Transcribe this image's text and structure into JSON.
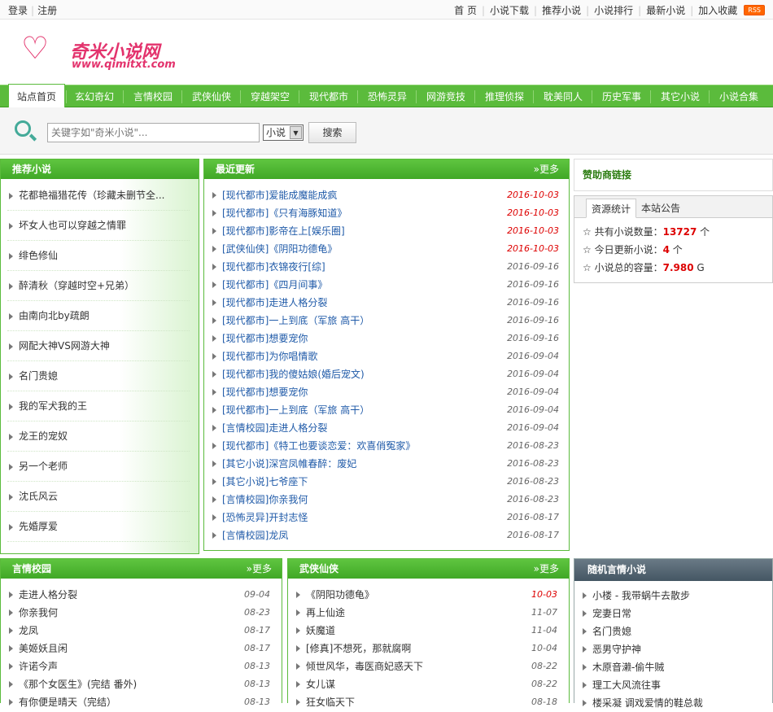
{
  "topbar": {
    "login": "登录",
    "register": "注册",
    "links": [
      "首 页",
      "小说下载",
      "推荐小说",
      "小说排行",
      "最新小说",
      "加入收藏"
    ],
    "rss": "RSS"
  },
  "logo": {
    "title": "奇米小说网",
    "domain": "www.qimitxt.com",
    "heart": "♡"
  },
  "nav": {
    "items": [
      "站点首页",
      "玄幻奇幻",
      "言情校园",
      "武侠仙侠",
      "穿越架空",
      "现代都市",
      "恐怖灵异",
      "网游竞技",
      "推理侦探",
      "耽美同人",
      "历史军事",
      "其它小说",
      "小说合集"
    ]
  },
  "search": {
    "placeholder": "关键字如\"奇米小说\"...",
    "select_value": "小说",
    "button": "搜索"
  },
  "recommend": {
    "title": "推荐小说",
    "items": [
      "花都艳福猎花传（珍藏未删节全...",
      "坏女人也可以穿越之情罪",
      "绯色修仙",
      "醉清秋（穿越时空+兄弟）",
      "由南向北by疏朗",
      "网配大神VS网游大神",
      "名门贵媳",
      "我的军犬我的王",
      "龙王的宠奴",
      "另一个老师",
      "沈氏风云",
      "先婚厚爱"
    ]
  },
  "updates": {
    "title": "最近更新",
    "more": "»更多",
    "items": [
      {
        "cat": "[现代都市]",
        "title": "爱能成魔能成疯",
        "date": "2016-10-03",
        "hot": true
      },
      {
        "cat": "[现代都市]",
        "title": "《只有海豚知道》",
        "date": "2016-10-03",
        "hot": true
      },
      {
        "cat": "[现代都市]",
        "title": "影帝在上[娱乐圈]",
        "date": "2016-10-03",
        "hot": true
      },
      {
        "cat": "[武侠仙侠]",
        "title": "《阴阳功德龟》",
        "date": "2016-10-03",
        "hot": true
      },
      {
        "cat": "[现代都市]",
        "title": "衣锦夜行[综]",
        "date": "2016-09-16",
        "hot": false
      },
      {
        "cat": "[现代都市]",
        "title": "《四月间事》",
        "date": "2016-09-16",
        "hot": false
      },
      {
        "cat": "[现代都市]",
        "title": "走进人格分裂",
        "date": "2016-09-16",
        "hot": false
      },
      {
        "cat": "[现代都市]",
        "title": "一上到底（军旅 高干）",
        "date": "2016-09-16",
        "hot": false
      },
      {
        "cat": "[现代都市]",
        "title": "想要宠你",
        "date": "2016-09-16",
        "hot": false
      },
      {
        "cat": "[现代都市]",
        "title": "为你唱情歌",
        "date": "2016-09-04",
        "hot": false
      },
      {
        "cat": "[现代都市]",
        "title": "我的傻姑娘(婚后宠文)",
        "date": "2016-09-04",
        "hot": false
      },
      {
        "cat": "[现代都市]",
        "title": "想要宠你",
        "date": "2016-09-04",
        "hot": false
      },
      {
        "cat": "[现代都市]",
        "title": "一上到底（军旅 高干）",
        "date": "2016-09-04",
        "hot": false
      },
      {
        "cat": "[言情校园]",
        "title": "走进人格分裂",
        "date": "2016-09-04",
        "hot": false
      },
      {
        "cat": "[现代都市]",
        "title": "《特工也要谈恋爱：欢喜俏冤家》",
        "date": "2016-08-23",
        "hot": false
      },
      {
        "cat": "[其它小说]",
        "title": "深宫凤帷春醉：废妃",
        "date": "2016-08-23",
        "hot": false
      },
      {
        "cat": "[其它小说]",
        "title": "七爷座下",
        "date": "2016-08-23",
        "hot": false
      },
      {
        "cat": "[言情校园]",
        "title": "你亲我何",
        "date": "2016-08-23",
        "hot": false
      },
      {
        "cat": "[恐怖灵异]",
        "title": "开封志怪",
        "date": "2016-08-17",
        "hot": false
      },
      {
        "cat": "[言情校园]",
        "title": "龙凤",
        "date": "2016-08-17",
        "hot": false
      }
    ]
  },
  "sponsor": {
    "title": "赞助商链接"
  },
  "stats": {
    "tab_active": "资源统计",
    "tab_other": "本站公告",
    "rows": [
      {
        "label": "共有小说数量：",
        "value": "13727",
        "unit": " 个"
      },
      {
        "label": "今日更新小说：",
        "value": "4",
        "unit": " 个"
      },
      {
        "label": "小说总的容量：",
        "value": "7.980",
        "unit": " G"
      }
    ],
    "star": "☆"
  },
  "romance": {
    "title": "言情校园",
    "more": "»更多",
    "items": [
      {
        "title": "走进人格分裂",
        "date": "09-04",
        "hot": false
      },
      {
        "title": "你亲我何",
        "date": "08-23",
        "hot": false
      },
      {
        "title": "龙凤",
        "date": "08-17",
        "hot": false
      },
      {
        "title": "美姬妖且闲",
        "date": "08-17",
        "hot": false
      },
      {
        "title": "许诺今声",
        "date": "08-13",
        "hot": false
      },
      {
        "title": "《那个女医生》(完结 番外)",
        "date": "08-13",
        "hot": false
      },
      {
        "title": "有你便是晴天（完结）",
        "date": "08-13",
        "hot": false
      }
    ]
  },
  "wuxia": {
    "title": "武侠仙侠",
    "more": "»更多",
    "items": [
      {
        "title": "《阴阳功德龟》",
        "date": "10-03",
        "hot": true
      },
      {
        "title": "再上仙途",
        "date": "11-07",
        "hot": false
      },
      {
        "title": "妖魔道",
        "date": "11-04",
        "hot": false
      },
      {
        "title": "[修真]不想死，那就腐啊",
        "date": "10-04",
        "hot": false
      },
      {
        "title": "倾世风华，毒医商妃惑天下",
        "date": "08-22",
        "hot": false
      },
      {
        "title": "女儿谋",
        "date": "08-22",
        "hot": false
      },
      {
        "title": "狂女临天下",
        "date": "08-18",
        "hot": false
      }
    ]
  },
  "random": {
    "title": "随机言情小说",
    "items": [
      "小楼 - 我带蜗牛去散步",
      "宠妻日常",
      "名门贵媳",
      "恶男守护神",
      "木原音濑-偷牛贼",
      "理工大风流往事",
      "楼采凝 调戏爱情的鞋总裁"
    ]
  }
}
